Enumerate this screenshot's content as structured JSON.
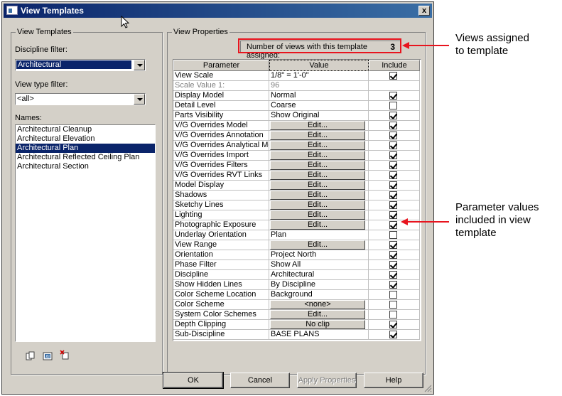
{
  "window": {
    "title": "View Templates",
    "close_label": "x"
  },
  "left_panel": {
    "group_title": "View Templates",
    "discipline_label": "Discipline filter:",
    "discipline_value": "Architectural",
    "view_type_label": "View type filter:",
    "view_type_value": "<all>",
    "names_label": "Names:",
    "names": [
      "Architectural Cleanup",
      "Architectural Elevation",
      "Architectural Plan",
      "Architectural Reflected Ceiling Plan",
      "Architectural Section"
    ],
    "selected_index": 2
  },
  "right_panel": {
    "group_title": "View Properties",
    "count_label": "Number of views with this template assigned:",
    "count_value": "3",
    "columns": [
      "Parameter",
      "Value",
      "Include"
    ],
    "rows": [
      {
        "param": "View Scale",
        "value": "1/8\" = 1'-0\"",
        "include": true,
        "type": "text"
      },
      {
        "param": "Scale Value    1:",
        "value": "96",
        "include": null,
        "type": "disabled"
      },
      {
        "param": "Display Model",
        "value": "Normal",
        "include": true,
        "type": "text"
      },
      {
        "param": "Detail Level",
        "value": "Coarse",
        "include": false,
        "type": "text"
      },
      {
        "param": "Parts Visibility",
        "value": "Show Original",
        "include": true,
        "type": "text"
      },
      {
        "param": "V/G Overrides Model",
        "value": "Edit...",
        "include": true,
        "type": "button"
      },
      {
        "param": "V/G Overrides Annotation",
        "value": "Edit...",
        "include": true,
        "type": "button"
      },
      {
        "param": "V/G Overrides Analytical Mod",
        "value": "Edit...",
        "include": true,
        "type": "button"
      },
      {
        "param": "V/G Overrides Import",
        "value": "Edit...",
        "include": true,
        "type": "button"
      },
      {
        "param": "V/G Overrides Filters",
        "value": "Edit...",
        "include": true,
        "type": "button"
      },
      {
        "param": "V/G Overrides RVT Links",
        "value": "Edit...",
        "include": true,
        "type": "button"
      },
      {
        "param": "Model Display",
        "value": "Edit...",
        "include": true,
        "type": "button"
      },
      {
        "param": "Shadows",
        "value": "Edit...",
        "include": true,
        "type": "button"
      },
      {
        "param": "Sketchy Lines",
        "value": "Edit...",
        "include": true,
        "type": "button"
      },
      {
        "param": "Lighting",
        "value": "Edit...",
        "include": true,
        "type": "button"
      },
      {
        "param": "Photographic Exposure",
        "value": "Edit...",
        "include": true,
        "type": "button"
      },
      {
        "param": "Underlay Orientation",
        "value": "Plan",
        "include": false,
        "type": "text"
      },
      {
        "param": "View Range",
        "value": "Edit...",
        "include": true,
        "type": "button"
      },
      {
        "param": "Orientation",
        "value": "Project North",
        "include": true,
        "type": "text"
      },
      {
        "param": "Phase Filter",
        "value": "Show All",
        "include": true,
        "type": "text"
      },
      {
        "param": "Discipline",
        "value": "Architectural",
        "include": true,
        "type": "text"
      },
      {
        "param": "Show Hidden Lines",
        "value": "By Discipline",
        "include": true,
        "type": "text"
      },
      {
        "param": "Color Scheme Location",
        "value": "Background",
        "include": false,
        "type": "text"
      },
      {
        "param": "Color Scheme",
        "value": "<none>",
        "include": false,
        "type": "button"
      },
      {
        "param": "System Color Schemes",
        "value": "Edit...",
        "include": false,
        "type": "button"
      },
      {
        "param": "Depth Clipping",
        "value": "No clip",
        "include": true,
        "type": "button"
      },
      {
        "param": "Sub-Discipline",
        "value": "BASE PLANS",
        "include": true,
        "type": "text"
      }
    ]
  },
  "buttons": {
    "ok": "OK",
    "cancel": "Cancel",
    "apply": "Apply Properties",
    "help": "Help"
  },
  "callouts": {
    "views_assigned": [
      "Views assigned",
      "to template"
    ],
    "parameter_values": [
      "Parameter values",
      "included in view",
      "template"
    ]
  },
  "colors": {
    "title_bar": "#0a246a",
    "dialog_bg": "#d4d0c8",
    "selection": "#0a246a",
    "callout_red": "#e8141e"
  }
}
